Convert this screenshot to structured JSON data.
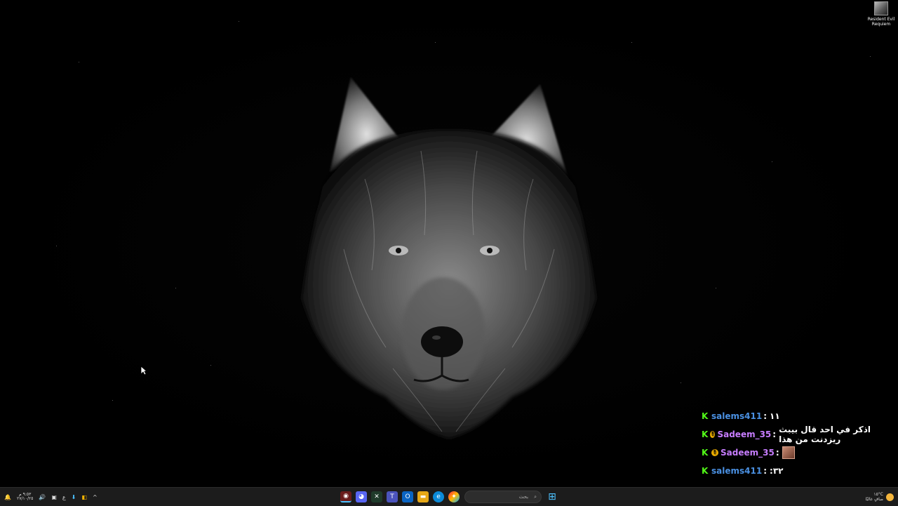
{
  "desktop": {
    "icons": [
      {
        "label_line1": "Resident Evil",
        "label_line2": "Requiem",
        "icon": "game-shortcut-icon"
      }
    ],
    "wallpaper": "wolf-portrait"
  },
  "chat": {
    "messages": [
      {
        "user": "salems411",
        "user_color": "#4a90e2",
        "badges": [
          "kick-badge"
        ],
        "text": "١١"
      },
      {
        "user": "Sadeem_35",
        "user_color": "#c77dff",
        "badges": [
          "kick-badge",
          "coin-badge"
        ],
        "text": "اذكر في احد قال بيبث ريزدنت من هذا"
      },
      {
        "user": "Sadeem_35",
        "user_color": "#c77dff",
        "badges": [
          "kick-badge",
          "coin-badge"
        ],
        "text": "",
        "emote": true
      },
      {
        "user": "salems411",
        "user_color": "#4a90e2",
        "badges": [
          "kick-badge"
        ],
        "text": ":٣٢"
      }
    ]
  },
  "taskbar": {
    "clock_time": "٩:٥٣ م",
    "clock_date": "٢٧/١٠/٢٥",
    "lang": "ع",
    "search_placeholder": "بحث",
    "weather_temp": "١٥°C",
    "weather_desc": "صافٍ غالبًا",
    "apps": [
      "obs-icon",
      "discord-icon",
      "terminal-icon",
      "teams-icon",
      "outlook-icon",
      "file-explorer-icon",
      "edge-icon",
      "copilot-icon"
    ]
  }
}
